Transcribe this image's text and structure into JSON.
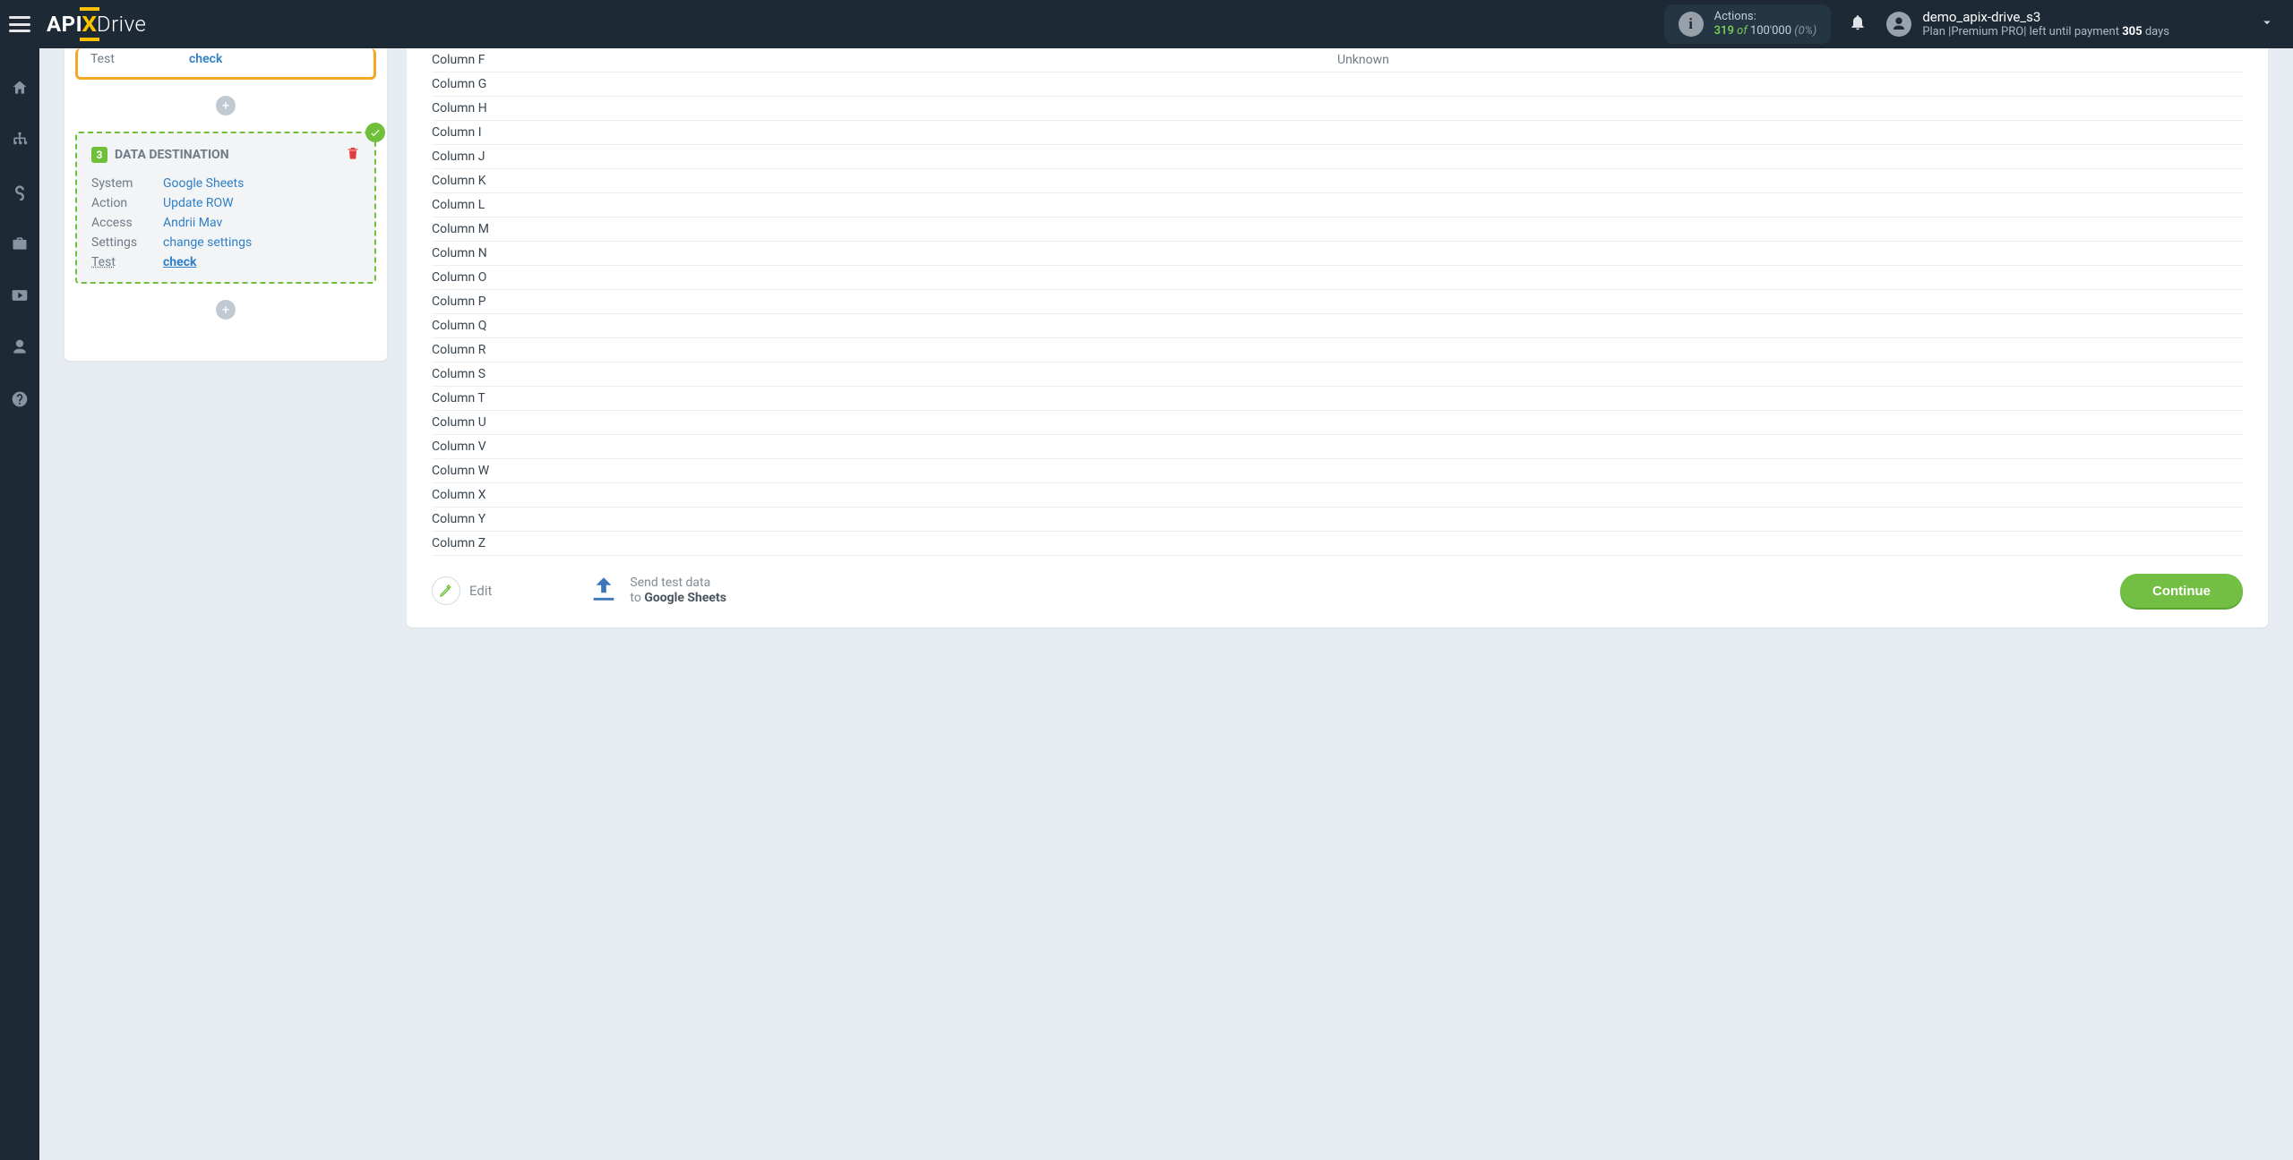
{
  "header": {
    "logo_a": "API",
    "logo_x": "X",
    "logo_d": "Drive",
    "actions_label": "Actions:",
    "actions_used": "319",
    "actions_of": "of",
    "actions_total": "100'000",
    "actions_pct": "(0%)",
    "user_name": "demo_apix-drive_s3",
    "plan_prefix": "Plan |",
    "plan_name": "Premium PRO",
    "plan_mid": "| left until payment ",
    "plan_days": "305",
    "plan_suffix": " days"
  },
  "block2": {
    "test_label": "Test",
    "test_link": "check"
  },
  "destination": {
    "badge": "3",
    "title": "DATA DESTINATION",
    "rows": {
      "system_k": "System",
      "system_v": "Google Sheets",
      "action_k": "Action",
      "action_v": "Update ROW",
      "access_k": "Access",
      "access_v": "Andrii Mav",
      "settings_k": "Settings",
      "settings_v": "change settings",
      "test_k": "Test",
      "test_v": "check"
    }
  },
  "columns": [
    {
      "name": "Column F",
      "val": "Unknown"
    },
    {
      "name": "Column G",
      "val": ""
    },
    {
      "name": "Column H",
      "val": ""
    },
    {
      "name": "Column I",
      "val": ""
    },
    {
      "name": "Column J",
      "val": ""
    },
    {
      "name": "Column K",
      "val": ""
    },
    {
      "name": "Column L",
      "val": ""
    },
    {
      "name": "Column M",
      "val": ""
    },
    {
      "name": "Column N",
      "val": ""
    },
    {
      "name": "Column O",
      "val": ""
    },
    {
      "name": "Column P",
      "val": ""
    },
    {
      "name": "Column Q",
      "val": ""
    },
    {
      "name": "Column R",
      "val": ""
    },
    {
      "name": "Column S",
      "val": ""
    },
    {
      "name": "Column T",
      "val": ""
    },
    {
      "name": "Column U",
      "val": ""
    },
    {
      "name": "Column V",
      "val": ""
    },
    {
      "name": "Column W",
      "val": ""
    },
    {
      "name": "Column X",
      "val": ""
    },
    {
      "name": "Column Y",
      "val": ""
    },
    {
      "name": "Column Z",
      "val": ""
    }
  ],
  "footer": {
    "edit": "Edit",
    "send_line1": "Send test data",
    "send_to": "to ",
    "send_dest": "Google Sheets",
    "continue": "Continue"
  }
}
